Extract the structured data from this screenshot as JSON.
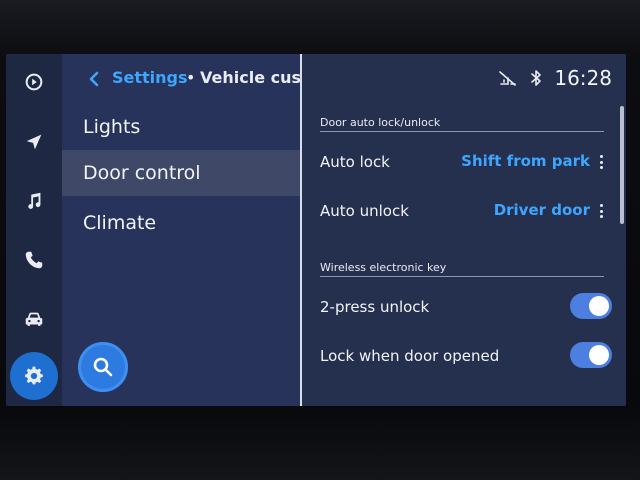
{
  "header": {
    "back_label": "<",
    "breadcrumb_root": "Settings",
    "breadcrumb_separator": "•",
    "page_title": "Vehicle customize"
  },
  "status": {
    "time": "16:28",
    "icons": [
      "no-signal-icon",
      "bluetooth-icon"
    ]
  },
  "rail": {
    "items": [
      {
        "icon": "android-auto-icon",
        "active": false
      },
      {
        "icon": "navigation-icon",
        "active": false
      },
      {
        "icon": "music-icon",
        "active": false
      },
      {
        "icon": "phone-icon",
        "active": false
      },
      {
        "icon": "car-icon",
        "active": false
      },
      {
        "icon": "settings-icon",
        "active": true
      }
    ]
  },
  "menu": {
    "items": [
      {
        "label": "Lights",
        "selected": false
      },
      {
        "label": "Door control",
        "selected": true
      },
      {
        "label": "Climate",
        "selected": false
      }
    ],
    "search_icon": "search-icon"
  },
  "panel": {
    "sections": [
      {
        "title": "Door auto lock/unlock",
        "rows": [
          {
            "label": "Auto lock",
            "value": "Shift from park"
          },
          {
            "label": "Auto unlock",
            "value": "Driver door"
          }
        ]
      },
      {
        "title": "Wireless electronic key",
        "rows": [
          {
            "label": "2-press unlock",
            "toggle_on": true
          },
          {
            "label": "Lock when door opened",
            "toggle_on": true
          }
        ]
      }
    ]
  },
  "colors": {
    "accent": "#3ea6ff",
    "active_rail": "#1f6fd0",
    "background": "#25304f"
  }
}
